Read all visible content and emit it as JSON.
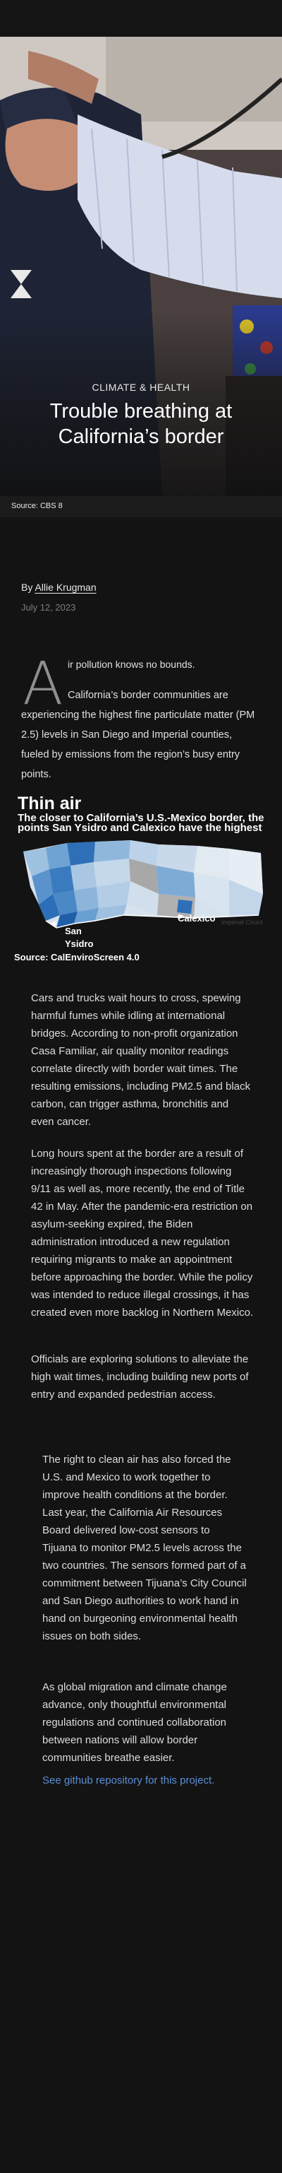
{
  "hero": {
    "kicker": "CLIMATE & HEALTH",
    "headline": "Trouble breathing at California’s border",
    "photo_source": "Source: CBS 8"
  },
  "byline": {
    "prefix": "By",
    "author": "Allie Krugman",
    "date": "July 12, 2023"
  },
  "intro": {
    "dropcap": "A",
    "first_line": "ir pollution knows no bounds.",
    "paragraph": "California’s border communities are experiencing the highest fine particulate matter (PM 2.5) levels in San Diego and Imperial counties, fueled by emissions from the region’s busy entry points."
  },
  "chart": {
    "title": "Thin air",
    "subtitle_line1": "The closer to California’s U.S.-Mexico border, the",
    "subtitle_line2": "points San Ysidro and Calexico have the highest",
    "label_san_ysidro_1": "San",
    "label_san_ysidro_2": "Ysidro",
    "label_calexico": "Calexico",
    "label_imperial": "Imperial Count",
    "source": "Source: CalEnviroScreen 4.0"
  },
  "body": {
    "p1": "Cars and trucks wait hours to cross, spewing harmful fumes while idling at international bridges. According to non-profit organization Casa Familiar, air quality monitor readings correlate directly with border wait times. The resulting emissions, including PM2.5 and black carbon, can trigger asthma, bronchitis and even cancer.",
    "p2": "Long hours spent at the border are a result of increasingly thorough inspections following 9/11 as well as, more recently, the end of Title 42 in May. After the pandemic-era restriction on asylum-seeking expired, the Biden administration introduced a new regulation requiring migrants to make an appointment before approaching the border. While the policy was intended to reduce illegal crossings, it has created even more backlog in Northern Mexico.",
    "p3": "Officials are exploring solutions to alleviate the high wait times, including building new ports of entry and expanded pedestrian access."
  },
  "aside": {
    "a1": "The right to clean air has also forced the U.S. and Mexico to work together to improve health conditions at the border. Last year, the California Air Resources Board delivered low-cost sensors to Tijuana to monitor PM2.5 levels across the two countries. The sensors formed part of a commitment between Tijuana’s City Council and San Diego authorities to work hand in hand on burgeoning environmental health issues on both sides.",
    "a2": "As global migration and climate change advance, only thoughtful environmental regulations and continued collaboration between nations will allow border communities breathe easier.",
    "link": "See github repository for this project."
  },
  "colors": {
    "background": "#131313",
    "link": "#5b8fd6",
    "map_high": "#2c6fb8",
    "map_low": "#dfe9f2"
  }
}
